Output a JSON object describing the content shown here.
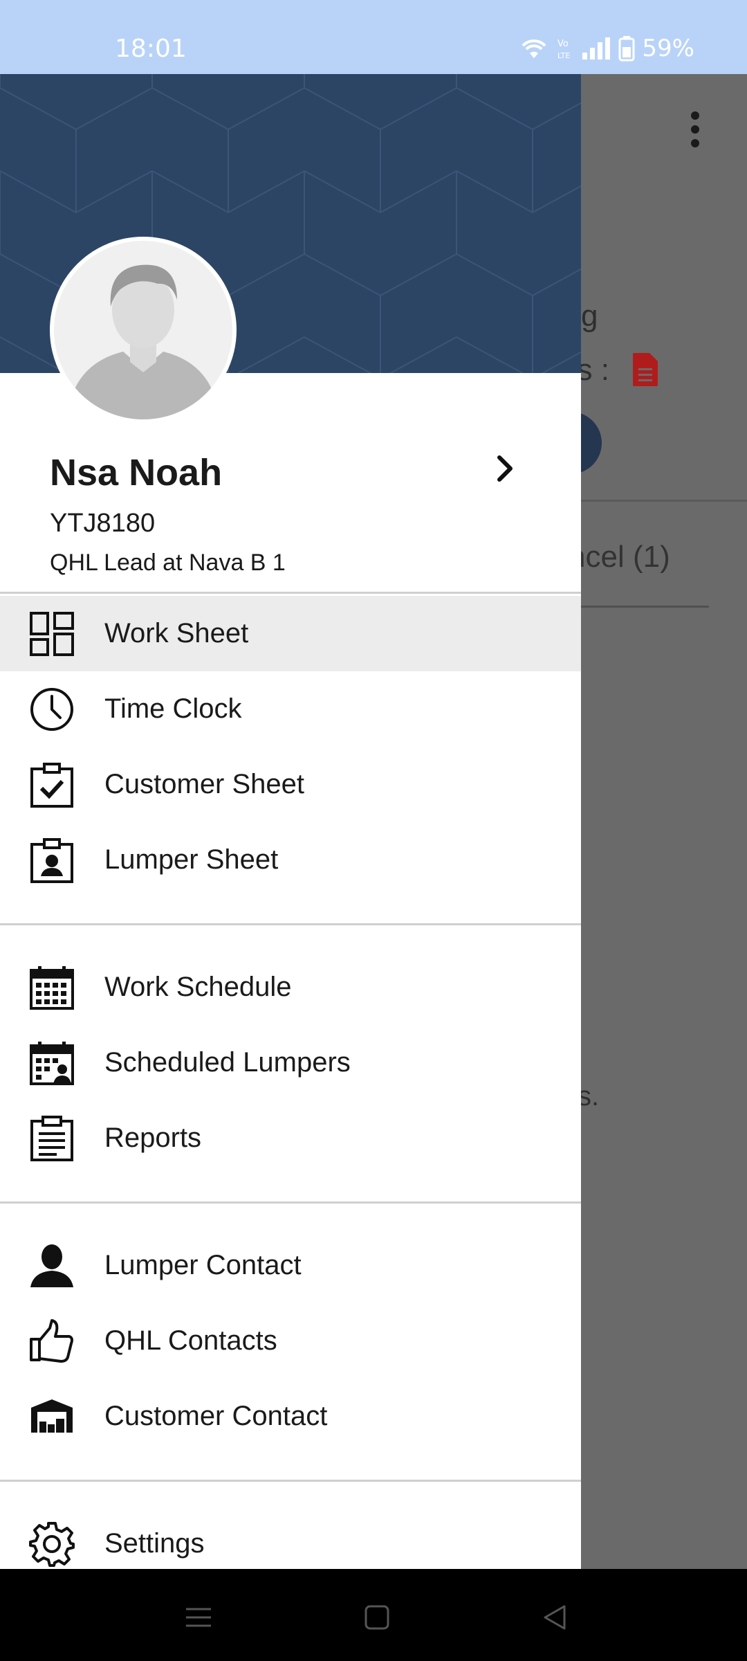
{
  "status_bar": {
    "time": "18:01",
    "battery": "59%",
    "icons": [
      "wifi-icon",
      "volte-icon",
      "signal-icon",
      "battery-icon"
    ]
  },
  "background_screen": {
    "partial_text_1": "g",
    "partial_text_2": "es :",
    "tab_partial": "ncel (1)",
    "partial_text_3": "s."
  },
  "drawer": {
    "profile": {
      "name": "Nsa Noah",
      "id": "YTJ8180",
      "role": "QHL Lead at Nava B 1"
    },
    "sections": [
      {
        "items": [
          {
            "label": "Work Sheet",
            "icon": "dashboard-icon",
            "selected": true
          },
          {
            "label": "Time Clock",
            "icon": "clock-icon"
          },
          {
            "label": "Customer Sheet",
            "icon": "clipboard-check-icon"
          },
          {
            "label": "Lumper Sheet",
            "icon": "clipboard-person-icon"
          }
        ]
      },
      {
        "items": [
          {
            "label": "Work Schedule",
            "icon": "calendar-icon"
          },
          {
            "label": "Scheduled Lumpers",
            "icon": "calendar-person-icon"
          },
          {
            "label": "Reports",
            "icon": "report-icon"
          }
        ]
      },
      {
        "items": [
          {
            "label": "Lumper Contact",
            "icon": "person-icon"
          },
          {
            "label": "QHL Contacts",
            "icon": "thumbs-up-icon"
          },
          {
            "label": "Customer Contact",
            "icon": "warehouse-icon"
          }
        ]
      },
      {
        "items": [
          {
            "label": "Settings",
            "icon": "gear-icon"
          }
        ]
      }
    ]
  },
  "colors": {
    "header_bg": "#2d4565",
    "status_bar_bg": "#b9d3f8",
    "selected_bg": "#ececec",
    "scrim": "#6a6a6a",
    "pdf_red": "#b01c1c"
  }
}
